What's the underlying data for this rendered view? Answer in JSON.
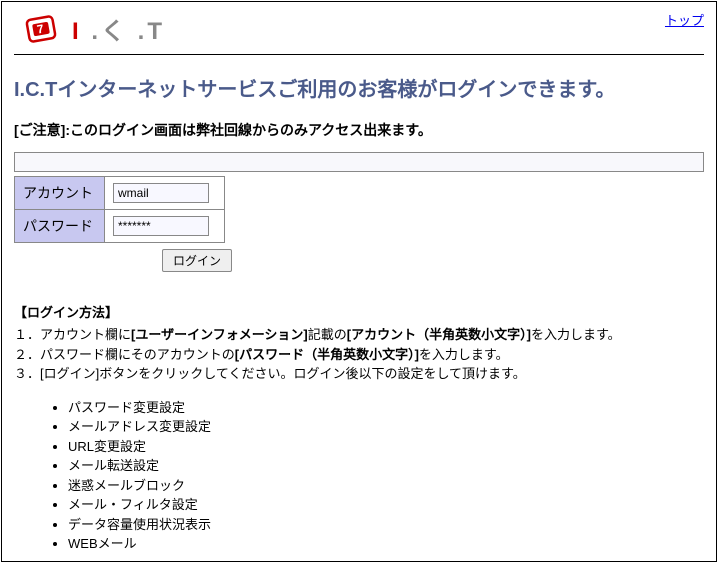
{
  "header": {
    "logo_text_i": "I",
    "logo_text_sep1": " .",
    "logo_text_c": "く",
    "logo_text_sep2": " .",
    "logo_text_t": "T",
    "top_link": "トップ"
  },
  "main": {
    "title": "I.C.Tインターネットサービスご利用のお客様がログインできます。",
    "notice": "[ご注意]:このログイン画面は弊社回線からのみアクセス出来ます。"
  },
  "login": {
    "account_label": "アカウント",
    "account_value": "wmail",
    "password_label": "パスワード",
    "password_value": "*******",
    "button": "ログイン"
  },
  "instructions": {
    "head": "【ログイン方法】",
    "step1_a": "１．アカウント欄に",
    "step1_b": "[ユーザーインフォメーション]",
    "step1_c": "記載の",
    "step1_d": "[アカウント（半角英数小文字）]",
    "step1_e": "を入力します。",
    "step2_a": "２．パスワード欄にそのアカウントの",
    "step2_b": "[パスワード（半角英数小文字）]",
    "step2_c": "を入力します。",
    "step3": "３．[ログイン]ボタンをクリックしてください。ログイン後以下の設定をして頂けます。"
  },
  "features": [
    "パスワード変更設定",
    "メールアドレス変更設定",
    "URL変更設定",
    "メール転送設定",
    "迷惑メールブロック",
    "メール・フィルタ設定",
    "データ容量使用状況表示",
    "WEBメール"
  ]
}
